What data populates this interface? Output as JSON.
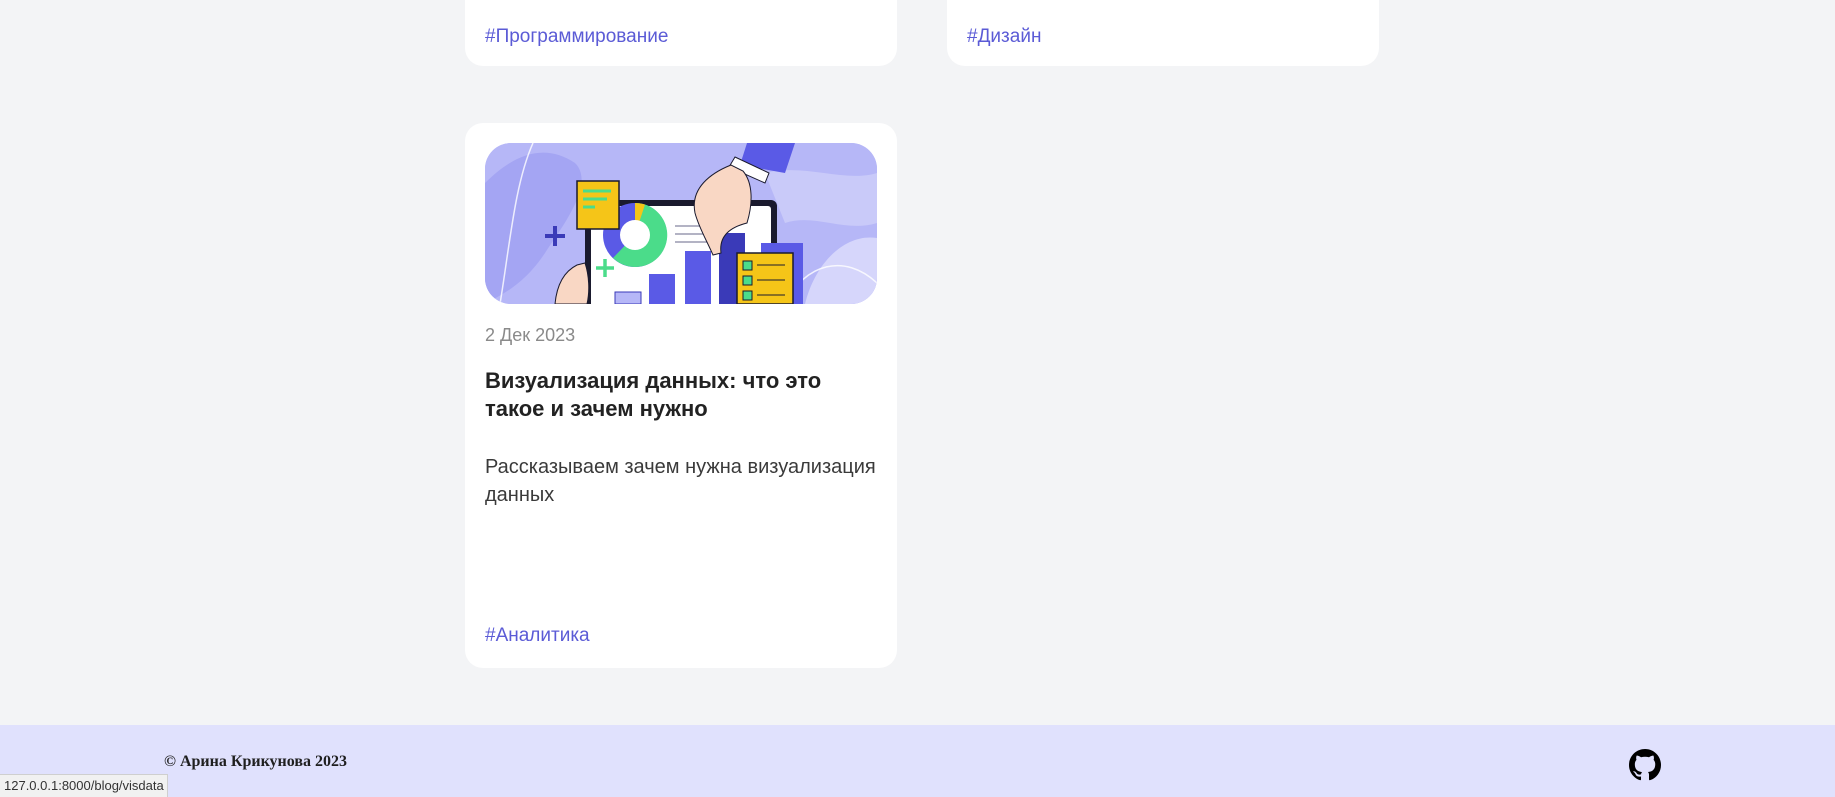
{
  "cards_top": [
    {
      "tag": "#Программирование"
    },
    {
      "tag": "#Дизайн"
    }
  ],
  "article": {
    "date": "2 Дек 2023",
    "title": "Визуализация данных: что это такое и зачем нужно",
    "excerpt": "Рассказываем зачем нужна визуализация данных",
    "tag": "#Аналитика",
    "image_icon": "data-visualization-illustration"
  },
  "footer": {
    "copyright": "© Арина Крикунова 2023",
    "github_icon": "github-icon"
  },
  "status_bar": {
    "url": "127.0.0.1:8000/blog/visdata"
  },
  "colors": {
    "page_bg": "#f3f4f6",
    "card_bg": "#ffffff",
    "tag_color": "#5b5bd6",
    "footer_bg": "#e0e1fd"
  }
}
